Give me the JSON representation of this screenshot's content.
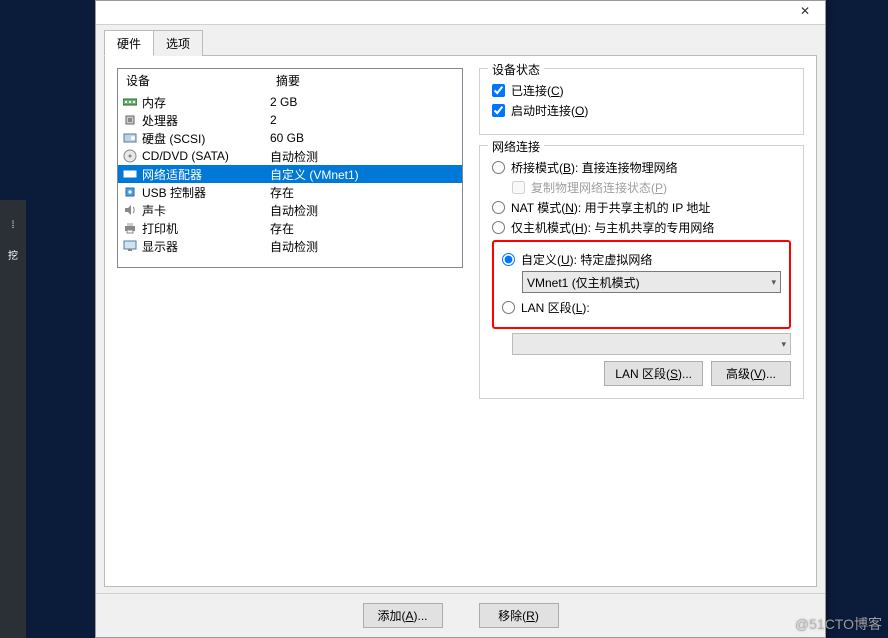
{
  "window": {
    "close_glyph": "✕"
  },
  "tabs": {
    "hardware": "硬件",
    "options": "选项"
  },
  "device_list": {
    "head_device": "设备",
    "head_summary": "摘要",
    "rows": [
      {
        "icon": "memory-icon",
        "name": "内存",
        "summary": "2 GB"
      },
      {
        "icon": "cpu-icon",
        "name": "处理器",
        "summary": "2"
      },
      {
        "icon": "disk-icon",
        "name": "硬盘 (SCSI)",
        "summary": "60 GB"
      },
      {
        "icon": "cd-icon",
        "name": "CD/DVD (SATA)",
        "summary": "自动检测"
      },
      {
        "icon": "net-icon",
        "name": "网络适配器",
        "summary": "自定义 (VMnet1)",
        "selected": true
      },
      {
        "icon": "usb-icon",
        "name": "USB 控制器",
        "summary": "存在"
      },
      {
        "icon": "sound-icon",
        "name": "声卡",
        "summary": "自动检测"
      },
      {
        "icon": "printer-icon",
        "name": "打印机",
        "summary": "存在"
      },
      {
        "icon": "display-icon",
        "name": "显示器",
        "summary": "自动检测"
      }
    ]
  },
  "device_status": {
    "title": "设备状态",
    "connected": "已连接(C)",
    "connect_on_boot": "启动时连接(O)",
    "connected_checked": true,
    "connect_on_boot_checked": true
  },
  "network": {
    "title": "网络连接",
    "bridged": "桥接模式(B): 直接连接物理网络",
    "bridged_sub": "复制物理网络连接状态(P)",
    "nat": "NAT 模式(N): 用于共享主机的 IP 地址",
    "hostonly": "仅主机模式(H): 与主机共享的专用网络",
    "custom": "自定义(U): 特定虚拟网络",
    "custom_vmnet": "VMnet1 (仅主机模式)",
    "lan_seg": "LAN 区段(L):",
    "selected": "custom"
  },
  "buttons": {
    "lan_segments": "LAN 区段(S)...",
    "advanced": "高级(V)...",
    "add": "添加(A)...",
    "remove": "移除(R)"
  },
  "watermark": "@51CTO博客"
}
